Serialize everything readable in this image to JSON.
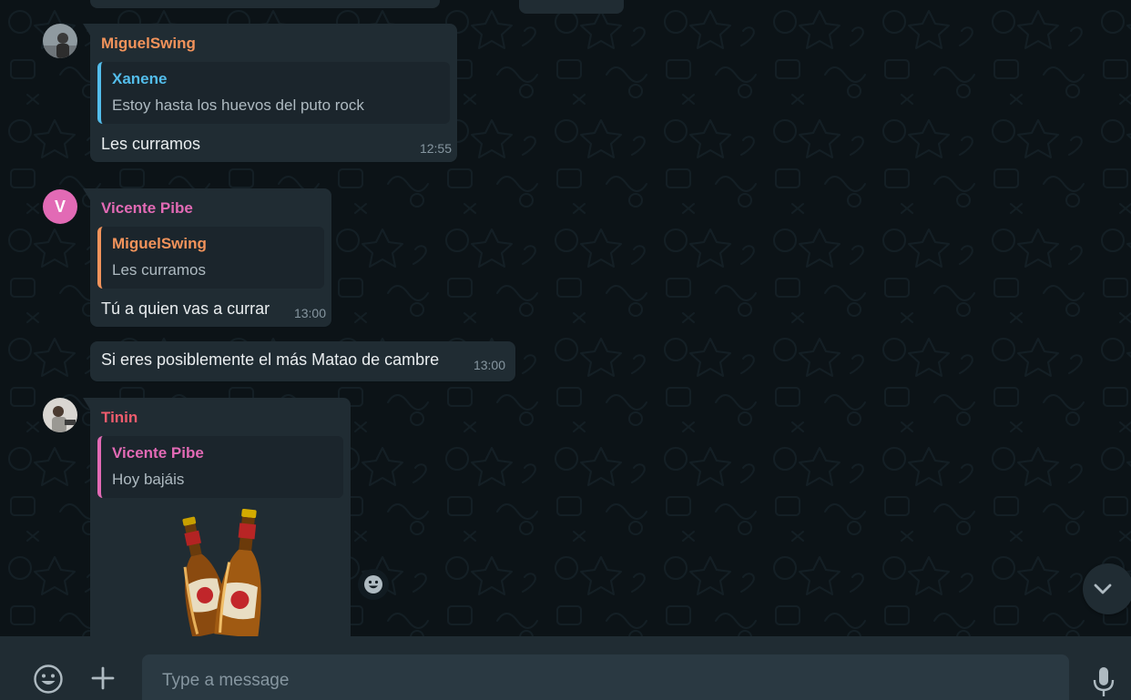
{
  "colors": {
    "chat_bg": "#0c1317",
    "bubble_bg": "#202c33",
    "miguel": "#f2935b",
    "xanene": "#53bdeb",
    "vicente": "#e26ab5",
    "tinin": "#f15c6d"
  },
  "messages": [
    {
      "sender": "MiguelSwing",
      "quote_author": "Xanene",
      "quote_text": "Estoy hasta los huevos del puto rock",
      "text": "Les curramos",
      "time": "12:55"
    },
    {
      "sender": "Vicente Pibe",
      "avatar_letter": "V",
      "quote_author": "MiguelSwing",
      "quote_text": "Les curramos",
      "text": "Tú a quien vas a currar",
      "time": "13:00"
    },
    {
      "text": "Si eres posiblemente el más Matao de cambre",
      "time": "13:00"
    },
    {
      "sender": "Tinin",
      "quote_author": "Vicente Pibe",
      "quote_text": "Hoy bajáis",
      "sticker": "beer-bottles-sticker"
    }
  ],
  "composer": {
    "placeholder": "Type a message",
    "emoji_icon": "emoji-icon",
    "attach_icon": "plus-icon",
    "mic_icon": "microphone-icon"
  },
  "controls": {
    "react_icon": "smiley-icon",
    "scroll_icon": "chevron-down-icon"
  }
}
